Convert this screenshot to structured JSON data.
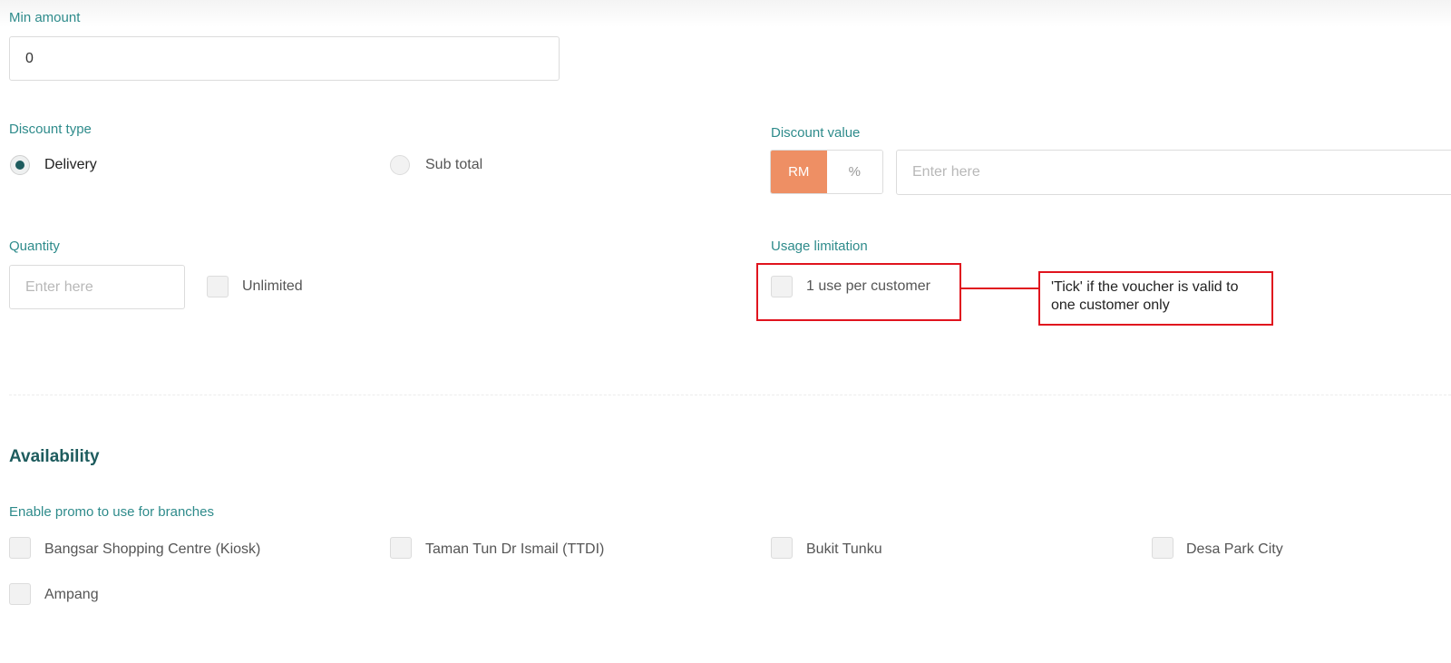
{
  "min_amount": {
    "label": "Min amount",
    "value": "0"
  },
  "discount_type": {
    "label": "Discount type",
    "options": [
      {
        "label": "Delivery",
        "selected": true
      },
      {
        "label": "Sub total",
        "selected": false
      }
    ]
  },
  "discount_value": {
    "label": "Discount value",
    "units": [
      {
        "label": "RM",
        "active": true
      },
      {
        "label": "%",
        "active": false
      }
    ],
    "placeholder": "Enter here"
  },
  "quantity": {
    "label": "Quantity",
    "placeholder": "Enter here",
    "unlimited_label": "Unlimited"
  },
  "usage_limitation": {
    "label": "Usage limitation",
    "option_label": "1 use per customer",
    "annotation_line1": "'Tick' if the voucher is valid to",
    "annotation_line2": "one customer only"
  },
  "availability": {
    "title": "Availability",
    "branches_label": "Enable promo to use for branches",
    "branches": [
      "Bangsar Shopping Centre (Kiosk)",
      "Taman Tun Dr Ismail (TTDI)",
      "Bukit Tunku",
      "Desa Park City",
      "Ampang"
    ]
  },
  "colors": {
    "label_teal": "#2e8b8b",
    "heading_teal": "#1e5c5e",
    "accent_orange": "#ee8f64",
    "annotation_red": "#e0141e"
  }
}
